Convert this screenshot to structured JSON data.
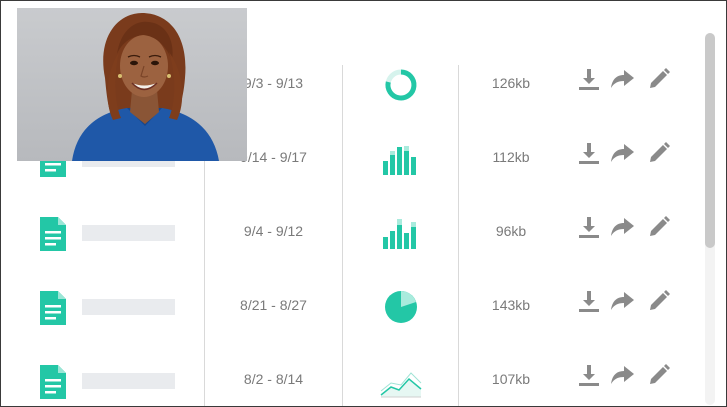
{
  "colors": {
    "accent": "#23c7a6",
    "icon_gray": "#8a8a8a",
    "placeholder": "#e9ebee",
    "text": "#7a7a7a"
  },
  "files": [
    {
      "date_range": "9/3 - 9/13",
      "chart": "donut-chart-icon",
      "size": "126kb"
    },
    {
      "date_range": "9/14 - 9/17",
      "chart": "bar-chart-icon",
      "size": "112kb"
    },
    {
      "date_range": "9/4 - 9/12",
      "chart": "bar-chart-icon",
      "size": "96kb"
    },
    {
      "date_range": "8/21 - 8/27",
      "chart": "pie-chart-icon",
      "size": "143kb"
    },
    {
      "date_range": "8/2 - 8/14",
      "chart": "area-chart-icon",
      "size": "107kb"
    }
  ],
  "actions": [
    "download-icon",
    "share-icon",
    "edit-icon"
  ],
  "video_overlay": {
    "subject": "webcam-feed"
  }
}
